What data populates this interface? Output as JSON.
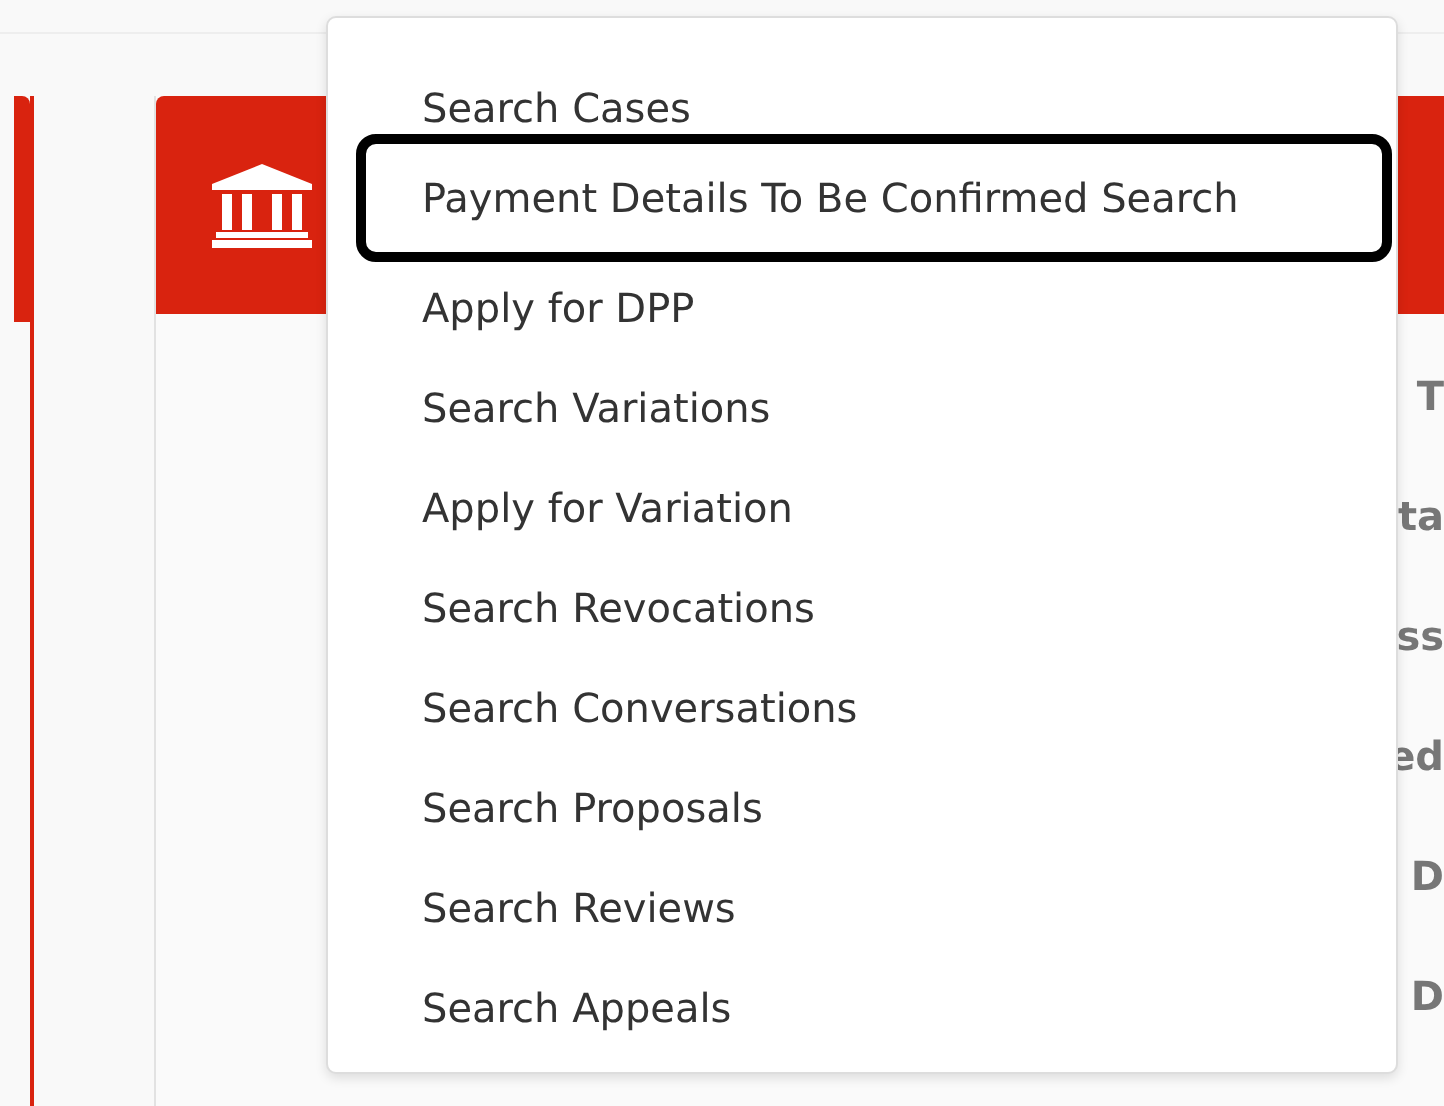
{
  "menu": {
    "items": [
      {
        "label": "Search Cases",
        "highlighted": false
      },
      {
        "label": "Payment Details To Be Confirmed Search",
        "highlighted": true
      },
      {
        "label": "Apply for DPP",
        "highlighted": false
      },
      {
        "label": "Search Variations",
        "highlighted": false
      },
      {
        "label": "Apply for Variation",
        "highlighted": false
      },
      {
        "label": "Search Revocations",
        "highlighted": false
      },
      {
        "label": "Search Conversations",
        "highlighted": false
      },
      {
        "label": "Search Proposals",
        "highlighted": false
      },
      {
        "label": "Search Reviews",
        "highlighted": false
      },
      {
        "label": "Search Appeals",
        "highlighted": false
      }
    ]
  },
  "card": {
    "fragments": [
      "T",
      "ta",
      "ss",
      "ed",
      "D",
      "D"
    ]
  }
}
